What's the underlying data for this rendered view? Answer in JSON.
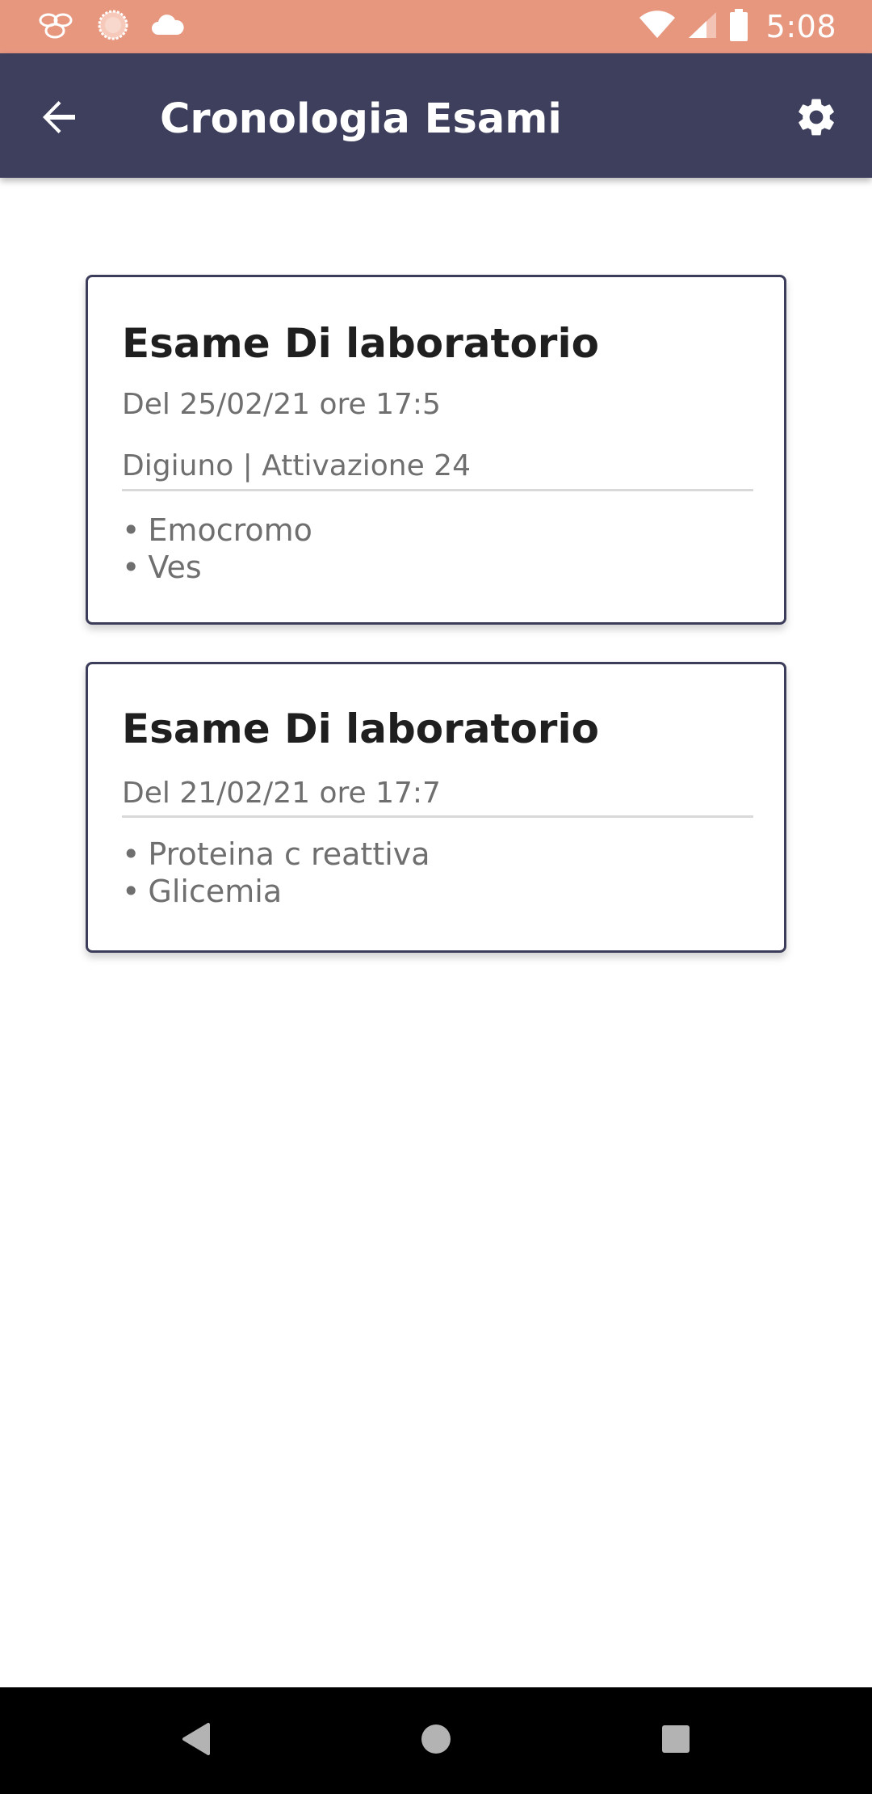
{
  "status_bar": {
    "time": "5:08",
    "icons_left": [
      "bubbles-notification-icon",
      "sun-notification-icon",
      "cloud-icon"
    ],
    "icons_right": [
      "wifi-icon",
      "signal-icon",
      "battery-icon"
    ]
  },
  "header": {
    "title": "Cronologia Esami",
    "back_icon": "arrow-back-icon",
    "settings_icon": "gear-icon"
  },
  "exams": [
    {
      "title": "Esame Di laboratorio",
      "date": "Del 25/02/21 ore 17:5",
      "details": "Digiuno | Attivazione 24",
      "items": [
        "Emocromo",
        "Ves"
      ]
    },
    {
      "title": "Esame Di laboratorio",
      "date": "Del 21/02/21 ore 17:7",
      "items": [
        "Proteina c reattiva",
        "Glicemia"
      ]
    }
  ],
  "bullet": "•",
  "nav": {
    "icons": [
      "nav-back-icon",
      "nav-home-icon",
      "nav-recents-icon"
    ]
  },
  "colors": {
    "status_bar": "#e8977f",
    "app_bar": "#3d3f5c",
    "card_border": "#3b3d5a",
    "title_text": "#1f1f1f",
    "secondary_text": "#6f6f6f"
  }
}
